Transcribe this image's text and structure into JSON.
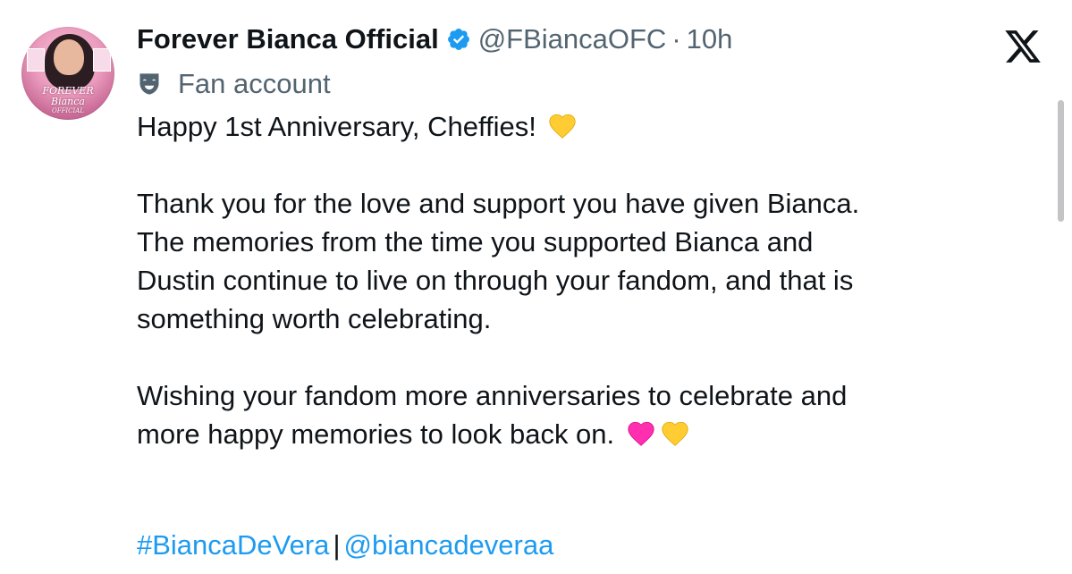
{
  "tweet": {
    "display_name": "Forever Bianca Official",
    "handle": "@FBiancaOFC",
    "separator": "·",
    "time": "10h",
    "account_label": "Fan account",
    "lines": [
      "Happy 1st Anniversary, Cheffies!",
      "",
      "Thank you for the love and support you have given Bianca.",
      "The memories from the time you supported Bianca and",
      "Dustin continue to live on through your fandom, and that is",
      "something worth celebrating.",
      "",
      "Wishing your fandom more anniversaries to celebrate and",
      "more happy memories to look back on."
    ],
    "hashtag": "#BiancaDeVera",
    "tag_separator": "|",
    "mention": "@biancadeveraa"
  },
  "avatar": {
    "logo_text_top": "FOREVER",
    "logo_text_bottom": "Bianca",
    "logo_text_small": "OFFICIAL"
  },
  "colors": {
    "link": "#1d9bf0",
    "secondary_text": "#536471",
    "primary_text": "#0f1419",
    "verified": "#1d9bf0",
    "yellow_heart": "#ffcc33",
    "pink_heart": "#ff2fb0"
  },
  "icons": {
    "verified": "verified-badge-icon",
    "label": "theater-mask-icon",
    "platform": "x-logo-icon",
    "emoji_1": "yellow-heart-icon",
    "emoji_2": "pink-heart-icon"
  }
}
